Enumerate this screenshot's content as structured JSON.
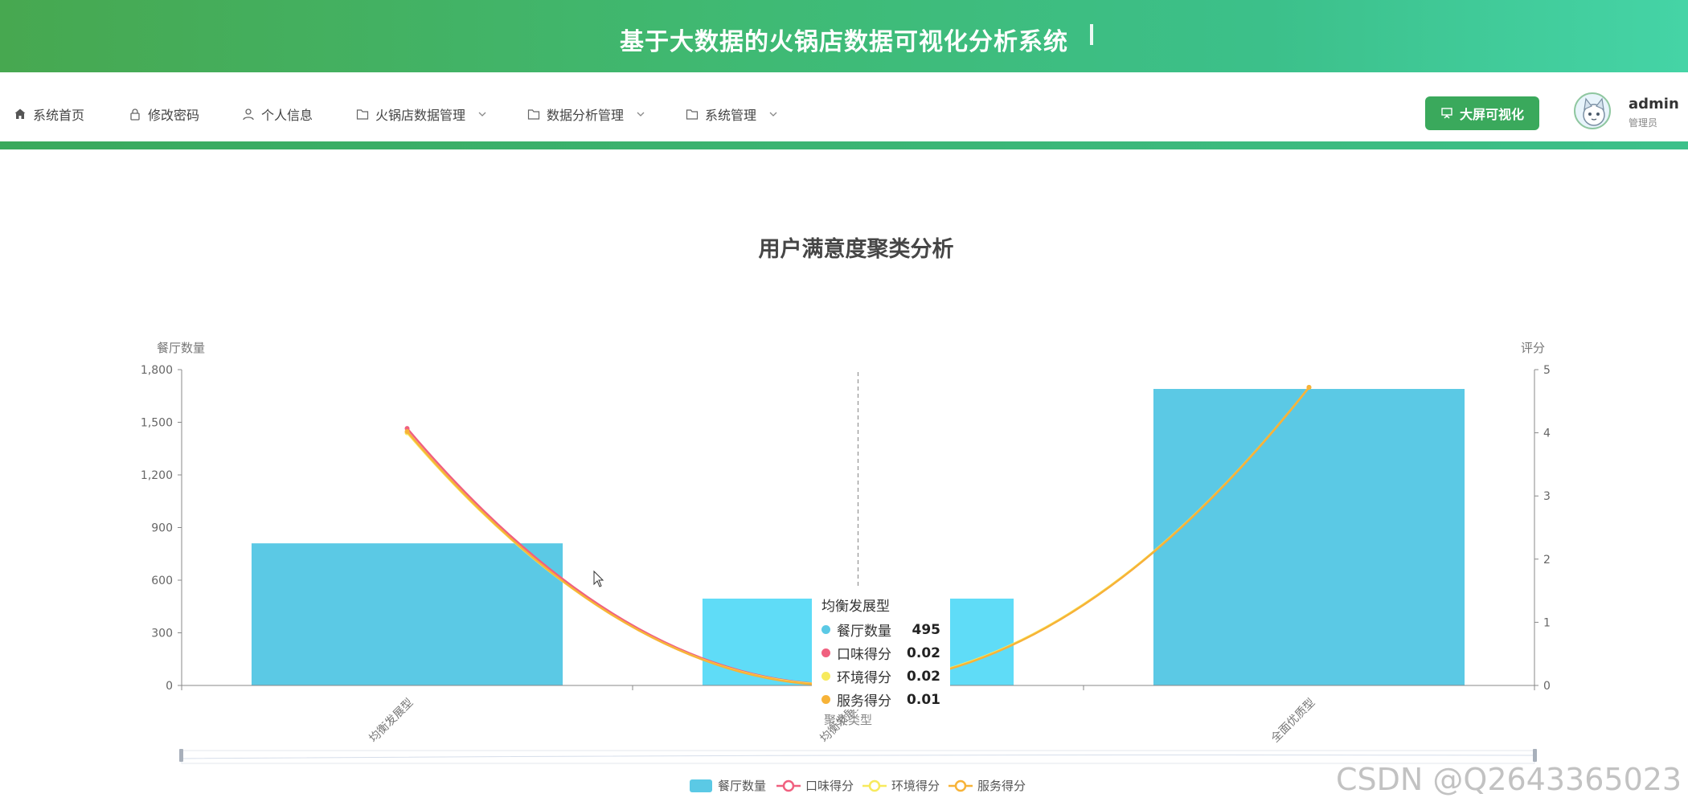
{
  "header": {
    "title": "基于大数据的火锅店数据可视化分析系统"
  },
  "nav": {
    "items": [
      {
        "label": "系统首页"
      },
      {
        "label": "修改密码"
      },
      {
        "label": "个人信息"
      },
      {
        "label": "火锅店数据管理"
      },
      {
        "label": "数据分析管理"
      },
      {
        "label": "系统管理"
      }
    ],
    "big_screen_label": "大屏可视化",
    "user": {
      "name": "admin",
      "role": "管理员"
    }
  },
  "chart_data": {
    "type": "bar",
    "title": "用户满意度聚类分析",
    "xlabel": "聚类类型",
    "ylabel_left": "餐厅数量",
    "ylabel_right": "评分",
    "categories": [
      "均衡发展型",
      "均衡发展型",
      "全面优质型"
    ],
    "left_axis": {
      "min": 0,
      "max": 1800,
      "ticks": [
        0,
        300,
        600,
        900,
        1200,
        1500,
        1800
      ],
      "tick_labels": [
        "0",
        "300",
        "600",
        "900",
        "1,200",
        "1,500",
        "1,800"
      ]
    },
    "right_axis": {
      "min": 0,
      "max": 5,
      "ticks": [
        0,
        1,
        2,
        3,
        4,
        5
      ]
    },
    "series": [
      {
        "name": "餐厅数量",
        "type": "bar",
        "axis": "left",
        "color": "#5bc9e5",
        "values": [
          810,
          495,
          1690
        ]
      },
      {
        "name": "口味得分",
        "type": "line",
        "axis": "right",
        "color": "#f0607f",
        "values": [
          4.07,
          0.02,
          4.72
        ]
      },
      {
        "name": "环境得分",
        "type": "line",
        "axis": "right",
        "color": "#f7ea5d",
        "values": [
          4.0,
          0.02,
          4.72
        ]
      },
      {
        "name": "服务得分",
        "type": "line",
        "axis": "right",
        "color": "#f7b338",
        "values": [
          4.02,
          0.01,
          4.72
        ]
      }
    ],
    "legend_position": "bottom-center",
    "grid": false,
    "tooltip": {
      "title": "均衡发展型",
      "rows": [
        {
          "name": "餐厅数量",
          "value": "495",
          "color": "#5bc9e5"
        },
        {
          "name": "口味得分",
          "value": "0.02",
          "color": "#f0607f"
        },
        {
          "name": "环境得分",
          "value": "0.02",
          "color": "#f7ea5d"
        },
        {
          "name": "服务得分",
          "value": "0.01",
          "color": "#f7b338"
        }
      ]
    }
  },
  "watermark": "CSDN @Q2643365023"
}
